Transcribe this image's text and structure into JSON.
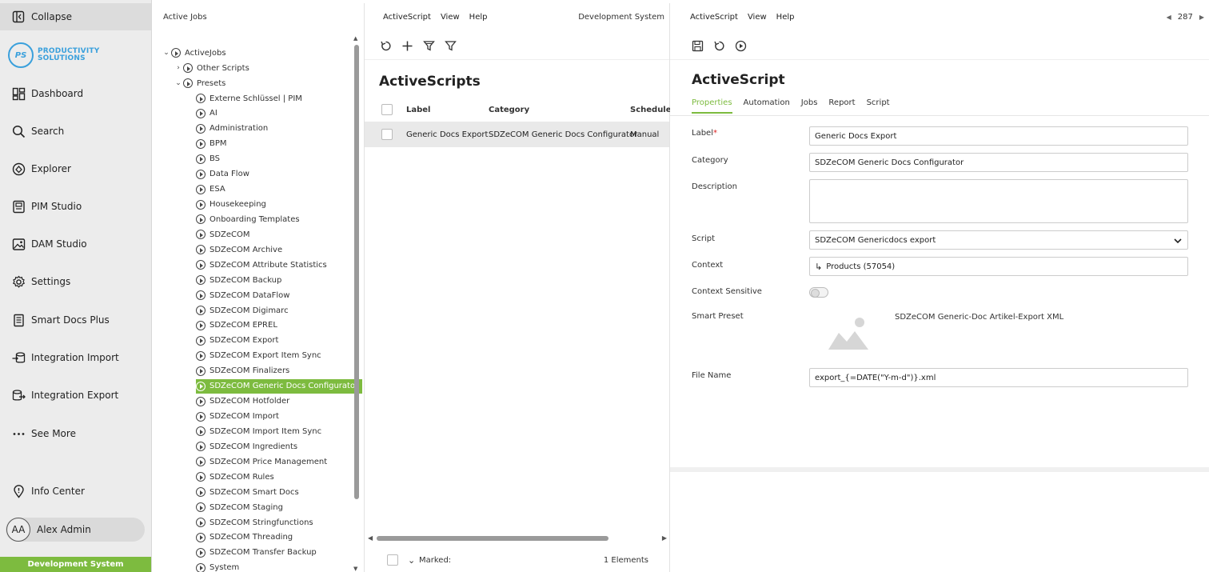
{
  "nav": {
    "collapse": "Collapse",
    "logo_initials": "PS",
    "logo_line1": "PRODUCTIVITY",
    "logo_line2": "SOLUTIONS",
    "items": [
      {
        "label": "Dashboard",
        "icon": "dashboard-icon"
      },
      {
        "label": "Search",
        "icon": "search-icon"
      },
      {
        "label": "Explorer",
        "icon": "explorer-icon"
      },
      {
        "label": "PIM Studio",
        "icon": "pim-studio-icon"
      },
      {
        "label": "DAM Studio",
        "icon": "image-icon"
      },
      {
        "label": "Settings",
        "icon": "gear-icon"
      },
      {
        "label": "Smart Docs Plus",
        "icon": "document-icon"
      },
      {
        "label": "Integration Import",
        "icon": "database-import-icon"
      },
      {
        "label": "Integration Export",
        "icon": "database-export-icon"
      },
      {
        "label": "See More",
        "icon": "more-dots-icon"
      }
    ],
    "info_center": "Info Center",
    "user_initials": "AA",
    "user_name": "Alex Admin",
    "environment": "Development System"
  },
  "tree": {
    "title": "Active Jobs",
    "root": "ActiveJobs",
    "other_scripts": "Other Scripts",
    "presets": "Presets",
    "items": [
      "Externe Schlüssel | PIM",
      "AI",
      "Administration",
      "BPM",
      "BS",
      "Data Flow",
      "ESA",
      "Housekeeping",
      "Onboarding Templates",
      "SDZeCOM",
      "SDZeCOM Archive",
      "SDZeCOM Attribute Statistics",
      "SDZeCOM Backup",
      "SDZeCOM DataFlow",
      "SDZeCOM Digimarc",
      "SDZeCOM EPREL",
      "SDZeCOM Export",
      "SDZeCOM Export Item Sync",
      "SDZeCOM Finalizers",
      "SDZeCOM Generic Docs Configurator",
      "SDZeCOM Hotfolder",
      "SDZeCOM Import",
      "SDZeCOM Import Item Sync",
      "SDZeCOM Ingredients",
      "SDZeCOM Price Management",
      "SDZeCOM Rules",
      "SDZeCOM Smart Docs",
      "SDZeCOM Staging",
      "SDZeCOM Stringfunctions",
      "SDZeCOM Threading",
      "SDZeCOM Transfer Backup",
      "System"
    ],
    "selected": "SDZeCOM Generic Docs Configurator"
  },
  "list": {
    "menu": [
      "ActiveScript",
      "View",
      "Help"
    ],
    "environment": "Development System",
    "title": "ActiveScripts",
    "columns": [
      "Label",
      "Category",
      "Schedule"
    ],
    "rows": [
      {
        "label": "Generic Docs Export",
        "category": "SDZeCOM Generic Docs Configurator",
        "schedule": "Manual"
      }
    ],
    "marked_label": "Marked:",
    "elements": "1 Elements"
  },
  "detail": {
    "menu": [
      "ActiveScript",
      "View",
      "Help"
    ],
    "pager_value": "287",
    "title": "ActiveScript",
    "tabs": [
      "Properties",
      "Automation",
      "Jobs",
      "Report",
      "Script"
    ],
    "active_tab": "Properties",
    "fields": {
      "label_caption": "Label",
      "label_required": "*",
      "label_value": "Generic Docs Export",
      "category_caption": "Category",
      "category_value": "SDZeCOM Generic Docs Configurator",
      "description_caption": "Description",
      "description_value": "",
      "script_caption": "Script",
      "script_value": "SDZeCOM Genericdocs export",
      "context_caption": "Context",
      "context_value": "Products (57054)",
      "context_sensitive_caption": "Context Sensitive",
      "context_sensitive_on": false,
      "smart_preset_caption": "Smart Preset",
      "smart_preset_value": "SDZeCOM Generic-Doc Artikel-Export XML",
      "file_name_caption": "File Name",
      "file_name_value": "export_{=DATE(\"Y-m-d\")}.xml"
    }
  },
  "colors": {
    "accent": "#7dbb3f",
    "logo": "#3aa0dc"
  }
}
